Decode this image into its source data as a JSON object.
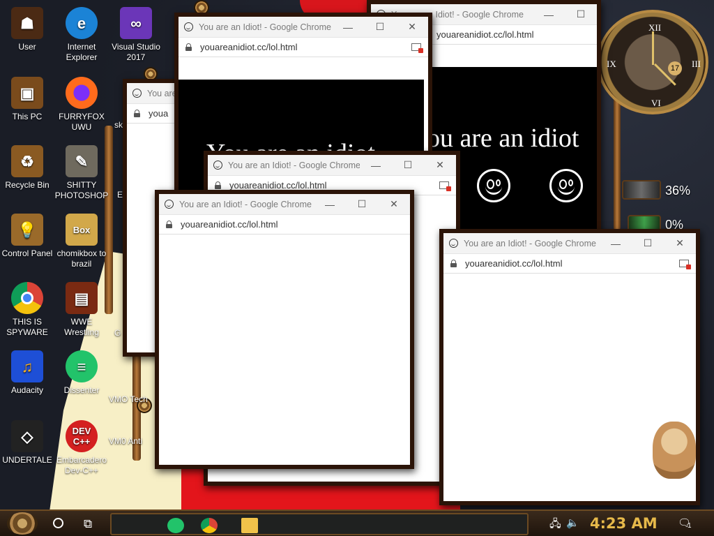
{
  "desktop_icons": [
    {
      "label": "User",
      "icon": "user-folder-icon",
      "color": "#4b2a14"
    },
    {
      "label": "Internet Explorer",
      "icon": "edge-icon",
      "color": "#1b83d6"
    },
    {
      "label": "Visual Studio 2017",
      "icon": "visual-studio-icon",
      "color": "#6b36b8"
    },
    {
      "label": "This PC",
      "icon": "computer-icon",
      "color": "#7a4b1c"
    },
    {
      "label": "FURRYFOX UWU",
      "icon": "firefox-icon",
      "color": "#ff6b1c"
    },
    {
      "label": "Recycle Bin",
      "icon": "recycle-bin-icon",
      "color": "#8a5a22"
    },
    {
      "label": "SHITTY PHOTOSHOP",
      "icon": "gimp-icon",
      "color": "#6f6a5e"
    },
    {
      "label": "Control Panel",
      "icon": "lightbulb-icon",
      "color": "#9a6a2a"
    },
    {
      "label": "chomikbox to brazil",
      "icon": "chomikbox-icon",
      "color": "#d2a84a"
    },
    {
      "label": "THIS IS SPYWARE",
      "icon": "chrome-icon",
      "color": "#ffffff"
    },
    {
      "label": "WWE Wrestling",
      "icon": "wwe-icon",
      "color": "#7a2a12"
    },
    {
      "label": "Audacity",
      "icon": "audacity-icon",
      "color": "#1e4fd6"
    },
    {
      "label": "Dissenter",
      "icon": "dissenter-icon",
      "color": "#22c36a"
    },
    {
      "label": "UNDERTALE",
      "icon": "unity-icon",
      "color": "#222222"
    },
    {
      "label": "Embarcadero Dev-C++",
      "icon": "devcpp-icon",
      "color": "#d42020"
    }
  ],
  "partial_labels": {
    "vmo_tech": "VMO Tech",
    "vmo_anti": "VM0 Anti",
    "g_label": "G",
    "e_label": "E",
    "sk_label": "sk"
  },
  "browser": {
    "title": "You are an Idiot! - Google Chrome",
    "title_short": "You are",
    "url": "youareanidiot.cc/lol.html",
    "url_short": "youa",
    "minimize": "—",
    "maximize": "☐",
    "close": "✕",
    "page_text": "You are an idiot",
    "page_text_partial_1": "ou are an idiot",
    "page_text_partial_2": "You are an idiot"
  },
  "widgets": {
    "meter_1": "36%",
    "meter_2": "0%",
    "clock_day": "17",
    "clock_numerals": [
      "XII",
      "III",
      "VI",
      "IX"
    ]
  },
  "taskbar": {
    "time": "4:23 AM",
    "notification_count": "1"
  },
  "colors": {
    "window_frame": "#2b1408",
    "taskbar_time": "#e6b94a",
    "red_bg": "#e3151b"
  }
}
